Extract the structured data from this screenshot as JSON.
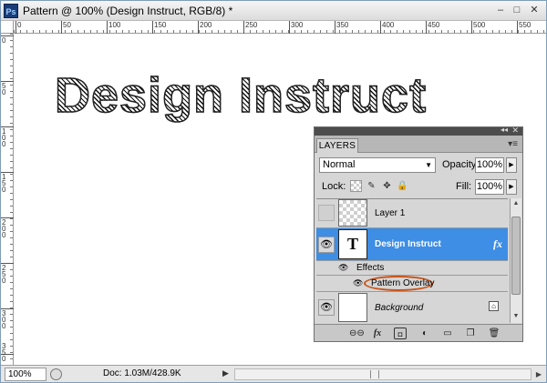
{
  "window": {
    "app_icon": "Ps",
    "title": "Pattern @ 100% (Design Instruct, RGB/8) *",
    "min_glyph": "–",
    "max_glyph": "□",
    "close_glyph": "✕"
  },
  "rulers": {
    "top_numbers": [
      "0",
      "50",
      "100",
      "150",
      "200",
      "250",
      "300",
      "350",
      "400",
      "450",
      "500",
      "550"
    ],
    "left_numbers": [
      "0",
      "50",
      "100",
      "150",
      "200",
      "250",
      "300",
      "350"
    ]
  },
  "canvas": {
    "text": "Design Instruct"
  },
  "statusbar": {
    "zoom": "100%",
    "doc_info": "Doc: 1.03M/428.9K",
    "arrow": "▶",
    "scroll_right": "▶"
  },
  "layers_panel": {
    "collapse_glyph": "◂◂",
    "close_glyph": "✕",
    "tab_label": "LAYERS",
    "menu_glyph": "▾≡",
    "blend_mode": "Normal",
    "blend_caret": "▼",
    "opacity_label": "Opacity:",
    "opacity_value": "100%",
    "lock_label": "Lock:",
    "fill_label": "Fill:",
    "fill_value": "100%",
    "arrow_glyph": "▶",
    "lock_brush_glyph": "✎",
    "lock_move_glyph": "✥",
    "lock_all_glyph": "🔒",
    "eye_glyph": "👁",
    "layers": [
      {
        "name": "Layer 1",
        "visible": false
      },
      {
        "name": "Design Instruct",
        "visible": true,
        "thumb": "T",
        "fx": "fx",
        "selected": true
      },
      {
        "name": "Effects"
      },
      {
        "name": "Pattern Overlay"
      },
      {
        "name": "Background",
        "visible": true,
        "locked": true
      }
    ],
    "lock_badge": "⌂",
    "scroll_up": "▲",
    "scroll_down": "▼",
    "footer": {
      "link": "⊖⊖",
      "fx": "fx",
      "mask": "◘",
      "adjust": "◐",
      "group": "▭",
      "new": "❐",
      "trash": "🗑"
    },
    "colors": {
      "selection": "#3d8ee4",
      "highlight_ring": "#c8541a"
    }
  }
}
